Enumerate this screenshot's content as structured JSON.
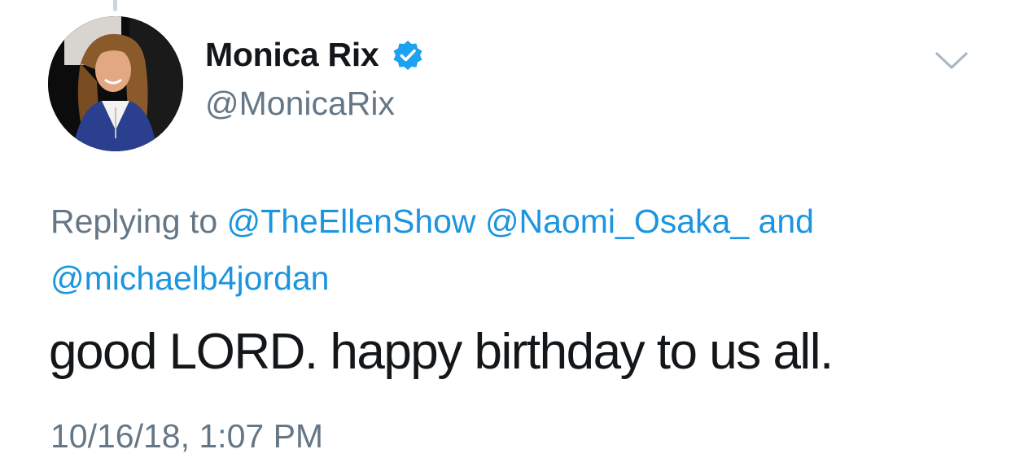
{
  "user": {
    "display_name": "Monica Rix",
    "handle": "@MonicaRix",
    "verified": true,
    "avatar_icon": "profile-photo"
  },
  "reply": {
    "prefix": "Replying to",
    "mentions": [
      "@TheEllenShow",
      "@Naomi_Osaka_"
    ],
    "conjunction": "and",
    "last_mention": "@michaelb4jordan"
  },
  "tweet": {
    "text": "good LORD. happy birthday to us all.",
    "timestamp": "10/16/18, 1:07 PM"
  },
  "icons": {
    "verified": "verified-badge-icon",
    "menu": "chevron-down-icon"
  },
  "colors": {
    "link": "#1b95e0",
    "secondary": "#657786",
    "primary_text": "#14171a"
  }
}
